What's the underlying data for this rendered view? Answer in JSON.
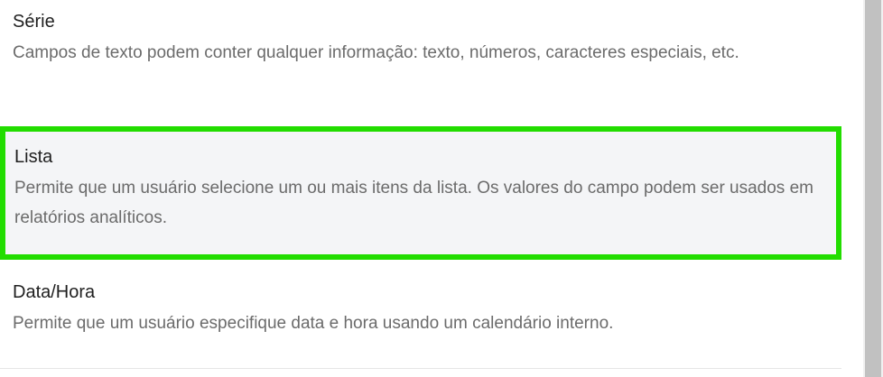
{
  "options": [
    {
      "title": "Série",
      "description": "Campos de texto podem conter qualquer informação: texto, números, caracteres especiais, etc."
    },
    {
      "title": "Lista",
      "description": "Permite que um usuário selecione um ou mais itens da lista. Os valores do campo podem ser usados em relatórios analíticos.",
      "highlighted": true
    },
    {
      "title": "Data/Hora",
      "description": "Permite que um usuário especifique data e hora usando um calendário interno."
    }
  ],
  "colors": {
    "highlight_border": "#22dd00",
    "highlight_background": "#f4f5f7",
    "title_text": "#1f1f1f",
    "description_text": "#6b6b6b"
  }
}
